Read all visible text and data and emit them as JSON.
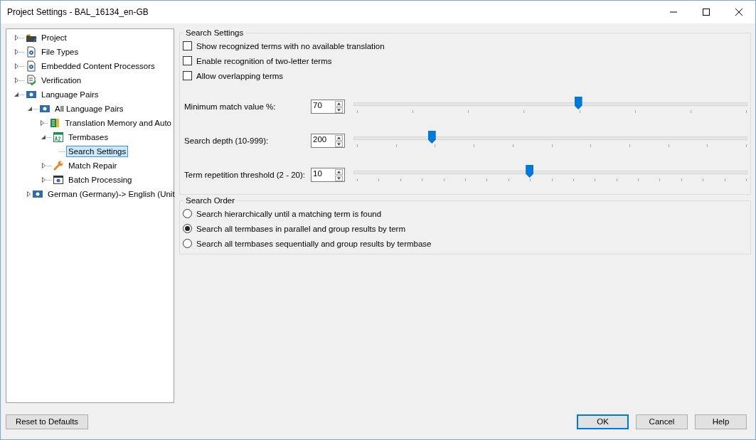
{
  "window": {
    "title": "Project Settings - BAL_16134_en-GB"
  },
  "tree": [
    {
      "label": "Project",
      "kind": "project",
      "selected": false,
      "expanded": false
    },
    {
      "label": "File Types",
      "kind": "gear-doc",
      "selected": false,
      "expanded": false
    },
    {
      "label": "Embedded Content Processors",
      "kind": "gear-doc",
      "selected": false,
      "expanded": false
    },
    {
      "label": "Verification",
      "kind": "check-doc",
      "selected": false,
      "expanded": false
    },
    {
      "label": "Language Pairs",
      "kind": "lang",
      "selected": false,
      "expanded": true,
      "children": [
        {
          "label": "All Language Pairs",
          "kind": "lang",
          "selected": false,
          "expanded": true,
          "children": [
            {
              "label": "Translation Memory and Auto",
              "kind": "tm",
              "selected": false,
              "expanded": false
            },
            {
              "label": "Termbases",
              "kind": "termbase",
              "selected": false,
              "expanded": true,
              "children": [
                {
                  "label": "Search Settings",
                  "selected": true
                }
              ]
            },
            {
              "label": "Match Repair",
              "kind": "wrench",
              "selected": false,
              "expanded": false
            },
            {
              "label": "Batch Processing",
              "kind": "batch",
              "selected": false,
              "expanded": false
            }
          ]
        },
        {
          "label": "German (Germany)-> English (Unit",
          "kind": "lang",
          "selected": false,
          "expanded": false
        }
      ]
    }
  ],
  "search_settings": {
    "title": "Search Settings",
    "checkboxes": [
      {
        "label": "Show recognized terms with no available translation",
        "checked": false
      },
      {
        "label": "Enable recognition of two-letter terms",
        "checked": false
      },
      {
        "label": "Allow overlapping terms",
        "checked": false
      }
    ],
    "sliders": [
      {
        "label": "Minimum match value %:",
        "value": "70",
        "level": 0.57
      },
      {
        "label": "Search depth (10-999):",
        "value": "200",
        "level": 0.197
      },
      {
        "label": "Term repetition threshold (2 - 20):",
        "value": "10",
        "level": 0.446
      }
    ]
  },
  "search_order": {
    "title": "Search Order",
    "options": [
      {
        "label": "Search hierarchically until a matching term is found",
        "selected": false
      },
      {
        "label": "Search all termbases in parallel and group results by term",
        "selected": true
      },
      {
        "label": "Search all termbases sequentially and group results by termbase",
        "selected": false
      }
    ]
  },
  "buttons": {
    "reset": "Reset to Defaults",
    "ok": "OK",
    "cancel": "Cancel",
    "help": "Help"
  }
}
